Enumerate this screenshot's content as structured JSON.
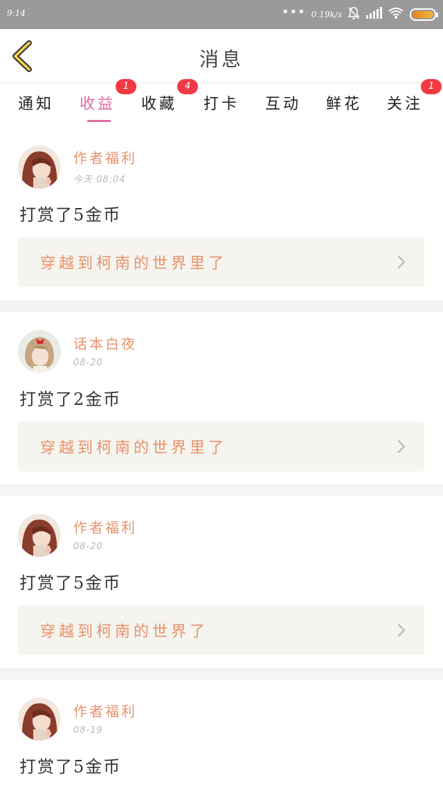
{
  "status_bar": {
    "time": "9:14",
    "net_speed": "0.19k/s",
    "dots": "•••",
    "icons": [
      "mute-icon",
      "signal-icon",
      "wifi-icon",
      "battery-icon"
    ]
  },
  "header": {
    "title": "消息"
  },
  "tabs": [
    {
      "label": "通知",
      "badge": ""
    },
    {
      "label": "收益",
      "badge": "1",
      "active": true
    },
    {
      "label": "收藏",
      "badge": "4"
    },
    {
      "label": "打卡",
      "badge": ""
    },
    {
      "label": "互动",
      "badge": ""
    },
    {
      "label": "鲜花",
      "badge": ""
    },
    {
      "label": "关注",
      "badge": "1"
    }
  ],
  "messages": [
    {
      "author": "作者福利",
      "time": "今天 08:04",
      "text": "打赏了5金币",
      "book": "穿越到柯南的世界里了",
      "avatar": "avatar-anime-girl"
    },
    {
      "author": "话本白夜",
      "time": "08-20",
      "text": "打赏了2金币",
      "book": "穿越到柯南的世界里了",
      "avatar": "avatar-girl-red-bow"
    },
    {
      "author": "作者福利",
      "time": "08-20",
      "text": "打赏了5金币",
      "book": "穿越到柯南的世界了",
      "avatar": "avatar-anime-girl"
    },
    {
      "author": "作者福利",
      "time": "08-19",
      "text": "打赏了5金币",
      "book": "",
      "avatar": "avatar-anime-girl"
    }
  ],
  "colors": {
    "accent_pink": "#e06aa0",
    "author_orange": "#e8926b",
    "badge_red": "#f23a45",
    "link_bg": "#f5f4ef"
  }
}
